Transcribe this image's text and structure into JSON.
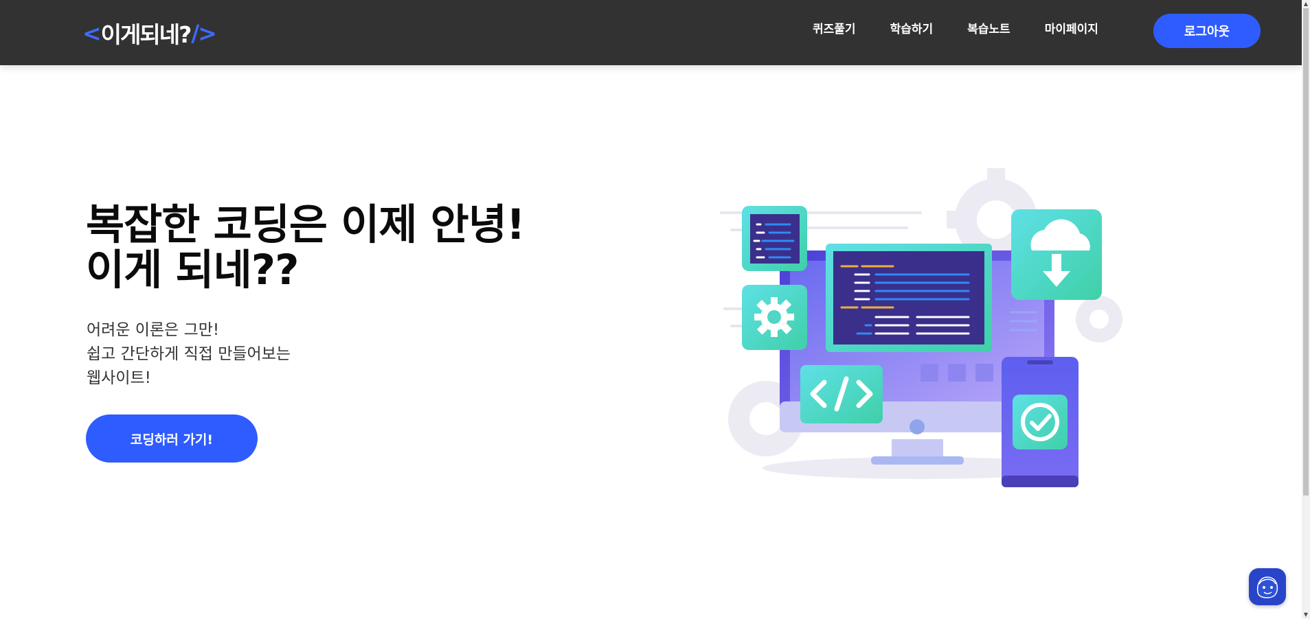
{
  "header": {
    "logo": {
      "open": "<",
      "text": "이게되네?",
      "close": "/>"
    },
    "nav": [
      {
        "label": "퀴즈풀기"
      },
      {
        "label": "학습하기"
      },
      {
        "label": "복습노트"
      },
      {
        "label": "마이페이지"
      }
    ],
    "logout_label": "로그아웃"
  },
  "hero": {
    "title_line1": "복잡한 코딩은 이제 안녕!",
    "title_line2": "이게 되네??",
    "sub_line1": "어려운 이론은 그만!",
    "sub_line2": "쉽고 간단하게 직접 만들어보는",
    "sub_line3": "웹사이트!",
    "cta_label": "코딩하러 가기!"
  },
  "icons": {
    "settings": "gear-icon",
    "code": "code-brackets-icon",
    "download": "cloud-download-icon",
    "check": "check-circle-icon",
    "chat": "chatbot-face-icon"
  },
  "colors": {
    "header_bg": "#323232",
    "accent": "#2f5cff",
    "logo_bracket": "#3b6cff",
    "chat_button": "#2845c9"
  }
}
